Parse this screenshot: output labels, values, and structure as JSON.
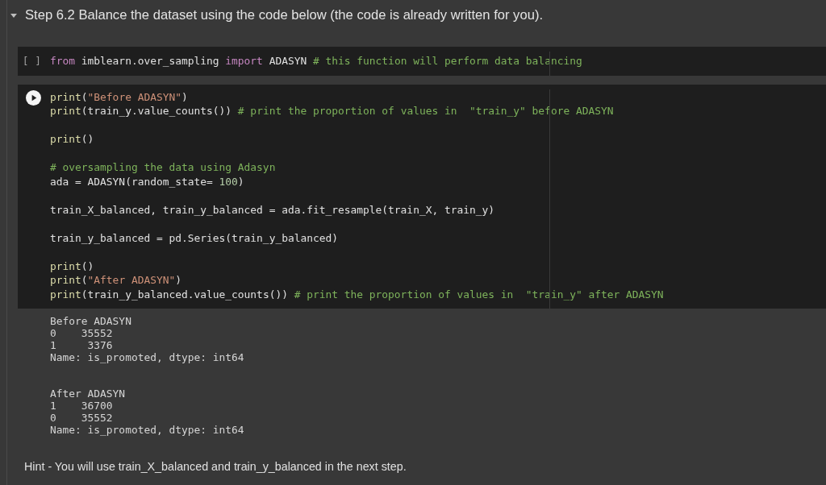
{
  "heading": {
    "text": "Step 6.2 Balance the dataset using the code below (the code is already written for you).",
    "expanded": true
  },
  "cells": [
    {
      "kind": "prompt",
      "prompt": "[ ]",
      "blocks": [
        [
          [
            {
              "kind": "kw",
              "text": "from"
            },
            {
              "kind": "txt",
              "text": " imblearn.over_sampling "
            },
            {
              "kind": "kw",
              "text": "import"
            },
            {
              "kind": "txt",
              "text": " ADASYN "
            },
            {
              "kind": "cmt",
              "text": "# this function will perform data balancing"
            }
          ]
        ]
      ]
    },
    {
      "kind": "run_button",
      "blocks": [
        [
          [
            {
              "kind": "fn",
              "text": "print"
            },
            {
              "kind": "txt",
              "text": "("
            },
            {
              "kind": "str",
              "text": "\"Before ADASYN\""
            },
            {
              "kind": "txt",
              "text": ")"
            }
          ],
          [
            {
              "kind": "fn",
              "text": "print"
            },
            {
              "kind": "txt",
              "text": "(train_y.value_counts()) "
            },
            {
              "kind": "cmt",
              "text": "# print the proportion of values in  \"train_y\" before ADASYN"
            }
          ]
        ],
        [
          [
            {
              "kind": "fn",
              "text": "print"
            },
            {
              "kind": "txt",
              "text": "()"
            }
          ]
        ],
        [
          [
            {
              "kind": "cmt",
              "text": "# oversampling the data using Adasyn"
            }
          ],
          [
            {
              "kind": "txt",
              "text": "ada = ADASYN(random_state= "
            },
            {
              "kind": "num",
              "text": "100"
            },
            {
              "kind": "txt",
              "text": ")"
            }
          ]
        ],
        [
          [
            {
              "kind": "txt",
              "text": "train_X_balanced, train_y_balanced = ada.fit_resample(train_X, train_y)"
            }
          ]
        ],
        [
          [
            {
              "kind": "txt",
              "text": "train_y_balanced = pd.Series(train_y_balanced)"
            }
          ]
        ],
        [
          [
            {
              "kind": "fn",
              "text": "print"
            },
            {
              "kind": "txt",
              "text": "()"
            }
          ],
          [
            {
              "kind": "fn",
              "text": "print"
            },
            {
              "kind": "txt",
              "text": "("
            },
            {
              "kind": "str",
              "text": "\"After ADASYN\""
            },
            {
              "kind": "txt",
              "text": ")"
            }
          ],
          [
            {
              "kind": "fn",
              "text": "print"
            },
            {
              "kind": "txt",
              "text": "(train_y_balanced.value_counts()) "
            },
            {
              "kind": "cmt",
              "text": "# print the proportion of values in  \"train_y\" after ADASYN"
            }
          ]
        ]
      ],
      "output": [
        [
          "Before ADASYN",
          "0    35552",
          "1     3376",
          "Name: is_promoted, dtype: int64"
        ],
        [
          "After ADASYN",
          "1    36700",
          "0    35552",
          "Name: is_promoted, dtype: int64"
        ]
      ]
    }
  ],
  "hint": "Hint - You will use train_X_balanced and train_y_balanced in the next step."
}
